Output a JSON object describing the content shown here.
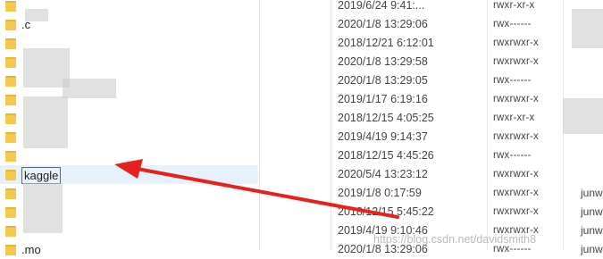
{
  "rows": [
    {
      "name": "",
      "date": "2019/6/24 9:41:...",
      "perm": "rwxr-xr-x",
      "owner": ""
    },
    {
      "name": ".c",
      "date": "2020/1/8 13:29:06",
      "perm": "rwx------",
      "owner": ""
    },
    {
      "name": "",
      "date": "2018/12/21 6:12:01",
      "perm": "rwxrwxr-x",
      "owner": ""
    },
    {
      "name": "",
      "date": "2020/1/8 13:29:58",
      "perm": "rwxrwxr-x",
      "owner": ""
    },
    {
      "name": "",
      "date": "2020/1/8 13:29:05",
      "perm": "rwx------",
      "owner": ""
    },
    {
      "name": "",
      "date": "2019/1/17 6:19:16",
      "perm": "rwxrwxr-x",
      "owner": ""
    },
    {
      "name": "",
      "date": "2018/12/15 4:05:25",
      "perm": "rwxr-xr-x",
      "owner": ""
    },
    {
      "name": "",
      "date": "2019/4/19 9:14:37",
      "perm": "rwxrwxr-x",
      "owner": ""
    },
    {
      "name": "",
      "date": "2018/12/15 4:45:26",
      "perm": "rwx------",
      "owner": ""
    },
    {
      "name": "kaggle",
      "date": "2020/5/4 13:23:12",
      "perm": "rwxrwxr-x",
      "owner": ""
    },
    {
      "name": "",
      "date": "2019/1/8 0:17:59",
      "perm": "rwxrwxr-x",
      "owner": "junwar"
    },
    {
      "name": "",
      "date": "2018/12/15 5:45:22",
      "perm": "rwxrwxr-x",
      "owner": "junwar"
    },
    {
      "name": "",
      "date": "2019/4/19 9:10:46",
      "perm": "rwxrwxr-x",
      "owner": "junwar"
    },
    {
      "name": ".mo",
      "date": "2020/1/8 13:29:06",
      "perm": "rwx------",
      "owner": "junwar"
    }
  ],
  "watermark": "https://blog.csdn.net/davidsmith8",
  "colors": {
    "arrow": "#e8211d",
    "folder": "#f5c94e",
    "selection": "#e5f1fb"
  },
  "selected_folder": "kaggle"
}
